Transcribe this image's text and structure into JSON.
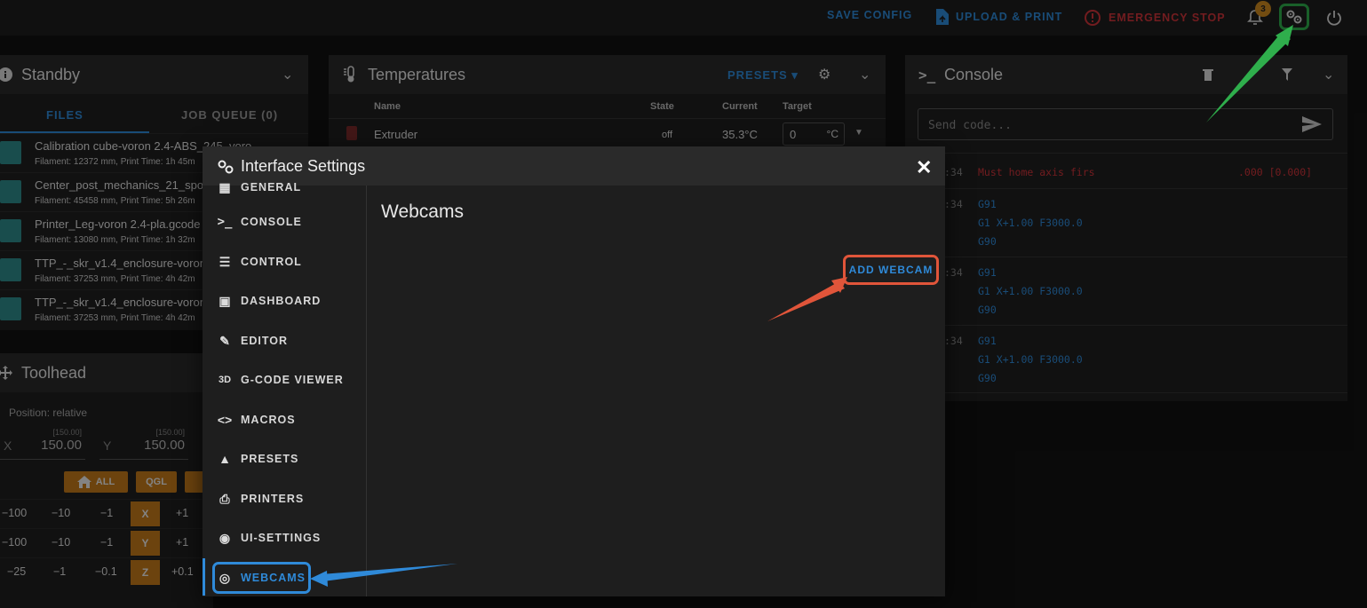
{
  "topbar": {
    "save_config": "SAVE CONFIG",
    "upload_print": "UPLOAD & PRINT",
    "emergency_stop": "EMERGENCY STOP",
    "notification_count": "3",
    "icons": [
      "bell-icon",
      "settings-gear-icon",
      "power-icon"
    ]
  },
  "standby": {
    "title": "Standby",
    "tabs": [
      "FILES",
      "JOB QUEUE (0)"
    ],
    "files": [
      {
        "name": "Calibration cube-voron 2.4-ABS_245_voro",
        "meta": "Filament: 12372 mm, Print Time: 1h 45m"
      },
      {
        "name": "Center_post_mechanics_21_spo",
        "meta": "Filament: 45458 mm, Print Time: 5h 26m"
      },
      {
        "name": "Printer_Leg-voron 2.4-pla.gcode",
        "meta": "Filament: 13080 mm, Print Time: 1h 32m"
      },
      {
        "name": "TTP_-_skr_v1.4_enclosure-voron",
        "meta": "Filament: 37253 mm, Print Time: 4h 42m"
      },
      {
        "name": "TTP_-_skr_v1.4_enclosure-voron",
        "meta": "Filament: 37253 mm, Print Time: 4h 42m"
      }
    ]
  },
  "toolhead": {
    "title": "Toolhead",
    "position_label": "Position: relative",
    "x": {
      "label": "X",
      "hint": "[150.00]",
      "value": "150.00"
    },
    "y": {
      "label": "Y",
      "hint": "[150.00]",
      "value": "150.00"
    },
    "home_all": "ALL",
    "qgl": "QGL",
    "rows": [
      {
        "axis": "X",
        "steps": [
          "−100",
          "−10",
          "−1"
        ],
        "plus": "+1"
      },
      {
        "axis": "Y",
        "steps": [
          "−100",
          "−10",
          "−1"
        ],
        "plus": "+1"
      },
      {
        "axis": "Z",
        "steps": [
          "−25",
          "−1",
          "−0.1"
        ],
        "plus": "+0.1"
      }
    ]
  },
  "temperatures": {
    "title": "Temperatures",
    "presets": "PRESETS",
    "headers": [
      "Name",
      "State",
      "Current",
      "Target"
    ],
    "rows": [
      {
        "name": "Extruder",
        "state": "off",
        "current": "35.3°C",
        "target": "0",
        "unit": "°C"
      }
    ]
  },
  "console": {
    "title": "Console",
    "placeholder": "Send code...",
    "entries": [
      {
        "time": ":34",
        "lines": [
          "Must home axis firs",
          ".000 [0.000]"
        ],
        "error": true
      },
      {
        "time": ":34",
        "lines": [
          "G91",
          "G1 X+1.00 F3000.0",
          "G90"
        ]
      },
      {
        "time": ":34",
        "lines": [
          "G91",
          "G1 X+1.00 F3000.0",
          "G90"
        ]
      },
      {
        "time": ":34",
        "lines": [
          "G91",
          "G1 X+1.00 F3000.0",
          "G90"
        ]
      }
    ]
  },
  "dialog": {
    "title": "Interface Settings",
    "content_title": "Webcams",
    "add_webcam": "ADD WEBCAM",
    "nav": [
      {
        "label": "GENERAL",
        "icon": "general-icon"
      },
      {
        "label": "CONSOLE",
        "icon": "console-icon"
      },
      {
        "label": "CONTROL",
        "icon": "control-sliders-icon"
      },
      {
        "label": "DASHBOARD",
        "icon": "dashboard-icon"
      },
      {
        "label": "EDITOR",
        "icon": "editor-icon"
      },
      {
        "label": "G-CODE VIEWER",
        "icon": "3d-icon"
      },
      {
        "label": "MACROS",
        "icon": "code-brackets-icon"
      },
      {
        "label": "PRESETS",
        "icon": "flame-icon"
      },
      {
        "label": "PRINTERS",
        "icon": "printer-icon"
      },
      {
        "label": "UI-SETTINGS",
        "icon": "palette-icon"
      },
      {
        "label": "WEBCAMS",
        "icon": "webcam-icon"
      }
    ]
  },
  "colors": {
    "accent": "#2f8ad9",
    "danger": "#d0343a",
    "highlight_green": "#2fae4c",
    "highlight_red": "#e0553a",
    "orange": "#c57a1a"
  }
}
